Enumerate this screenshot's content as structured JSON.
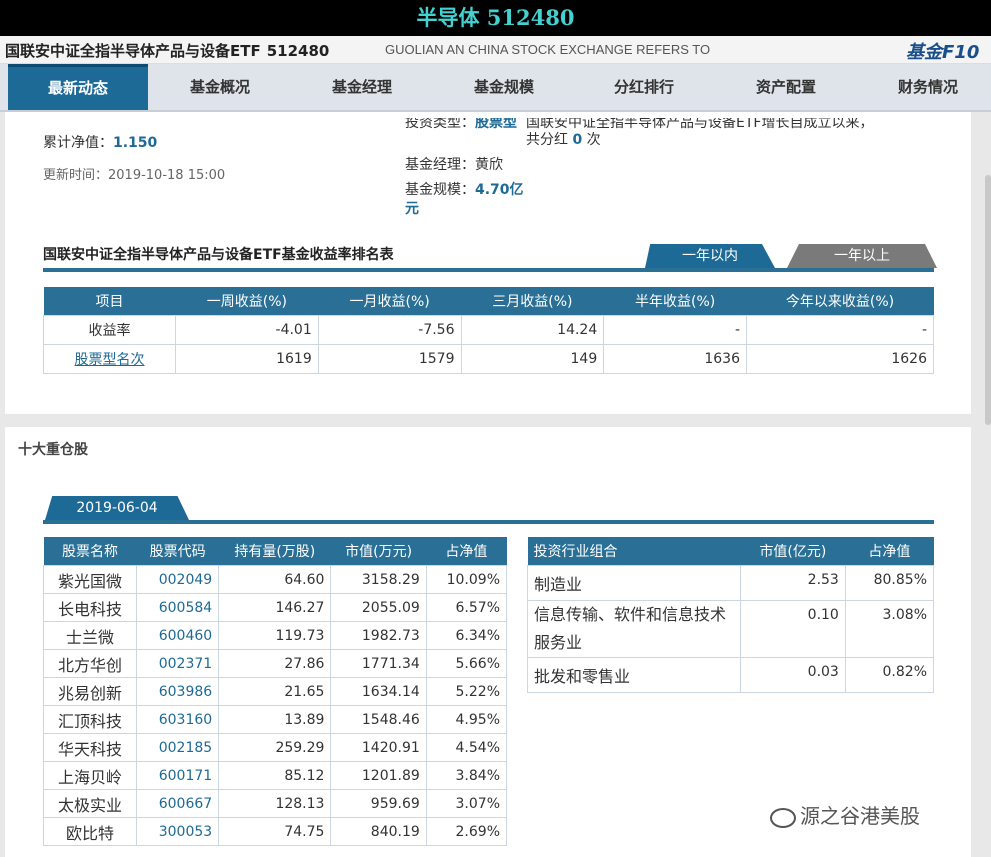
{
  "header": {
    "title": "半导体 512480",
    "fund_name": "国联安中证全指半导体产品与设备ETF",
    "fund_code": "512480",
    "fund_name_en": "GUOLIAN AN CHINA STOCK EXCHANGE REFERS TO",
    "logo": "基金F10"
  },
  "nav": {
    "items": [
      {
        "label": "最新动态",
        "active": true
      },
      {
        "label": "基金概况"
      },
      {
        "label": "基金经理"
      },
      {
        "label": "基金规模"
      },
      {
        "label": "分红排行"
      },
      {
        "label": "资产配置"
      },
      {
        "label": "财务情况"
      }
    ]
  },
  "summary": {
    "cum_nav_label": "累计净值：",
    "cum_nav_value": "1.150",
    "update_label": "更新时间：",
    "update_value": "2019-10-18 15:00",
    "type_label": "投资类型：",
    "type_value": "股票型",
    "dividend_text": "国联安中证全指半导体产品与设备ETF增长自成立以来，",
    "dividend_prefix": "共分红",
    "dividend_count": "0",
    "dividend_suffix": "次",
    "manager_label": "基金经理：",
    "manager_value": "黄欣",
    "scale_label": "基金规模：",
    "scale_value": "4.70亿元"
  },
  "rank": {
    "title": "国联安中证全指半导体产品与设备ETF基金收益率排名表",
    "tabs": [
      "一年以内",
      "一年以上"
    ],
    "headers": [
      "项目",
      "一周收益(%)",
      "一月收益(%)",
      "三月收益(%)",
      "半年收益(%)",
      "今年以来收益(%)"
    ],
    "rows": [
      [
        "收益率",
        "-4.01",
        "-7.56",
        "14.24",
        "-",
        "-"
      ],
      [
        "股票型名次",
        "1619",
        "1579",
        "149",
        "1636",
        "1626"
      ]
    ]
  },
  "holdings": {
    "title": "十大重仓股",
    "date_tab": "2019-06-04",
    "headers": [
      "股票名称",
      "股票代码",
      "持有量(万股)",
      "市值(万元)",
      "占净值"
    ],
    "rows": [
      [
        "紫光国微",
        "002049",
        "64.60",
        "3158.29",
        "10.09%"
      ],
      [
        "长电科技",
        "600584",
        "146.27",
        "2055.09",
        "6.57%"
      ],
      [
        "士兰微",
        "600460",
        "119.73",
        "1982.73",
        "6.34%"
      ],
      [
        "北方华创",
        "002371",
        "27.86",
        "1771.34",
        "5.66%"
      ],
      [
        "兆易创新",
        "603986",
        "21.65",
        "1634.14",
        "5.22%"
      ],
      [
        "汇顶科技",
        "603160",
        "13.89",
        "1548.46",
        "4.95%"
      ],
      [
        "华天科技",
        "002185",
        "259.29",
        "1420.91",
        "4.54%"
      ],
      [
        "上海贝岭",
        "600171",
        "85.12",
        "1201.89",
        "3.84%"
      ],
      [
        "太极实业",
        "600667",
        "128.13",
        "959.69",
        "3.07%"
      ],
      [
        "欧比特",
        "300053",
        "74.75",
        "840.19",
        "2.69%"
      ]
    ]
  },
  "industry": {
    "headers": [
      "投资行业组合",
      "市值(亿元)",
      "占净值"
    ],
    "rows": [
      [
        "制造业",
        "2.53",
        "80.85%"
      ],
      [
        "信息传输、软件和信息技术服务业",
        "0.10",
        "3.08%"
      ],
      [
        "批发和零售业",
        "0.03",
        "0.82%"
      ]
    ]
  },
  "watermark": "源之谷港美股"
}
